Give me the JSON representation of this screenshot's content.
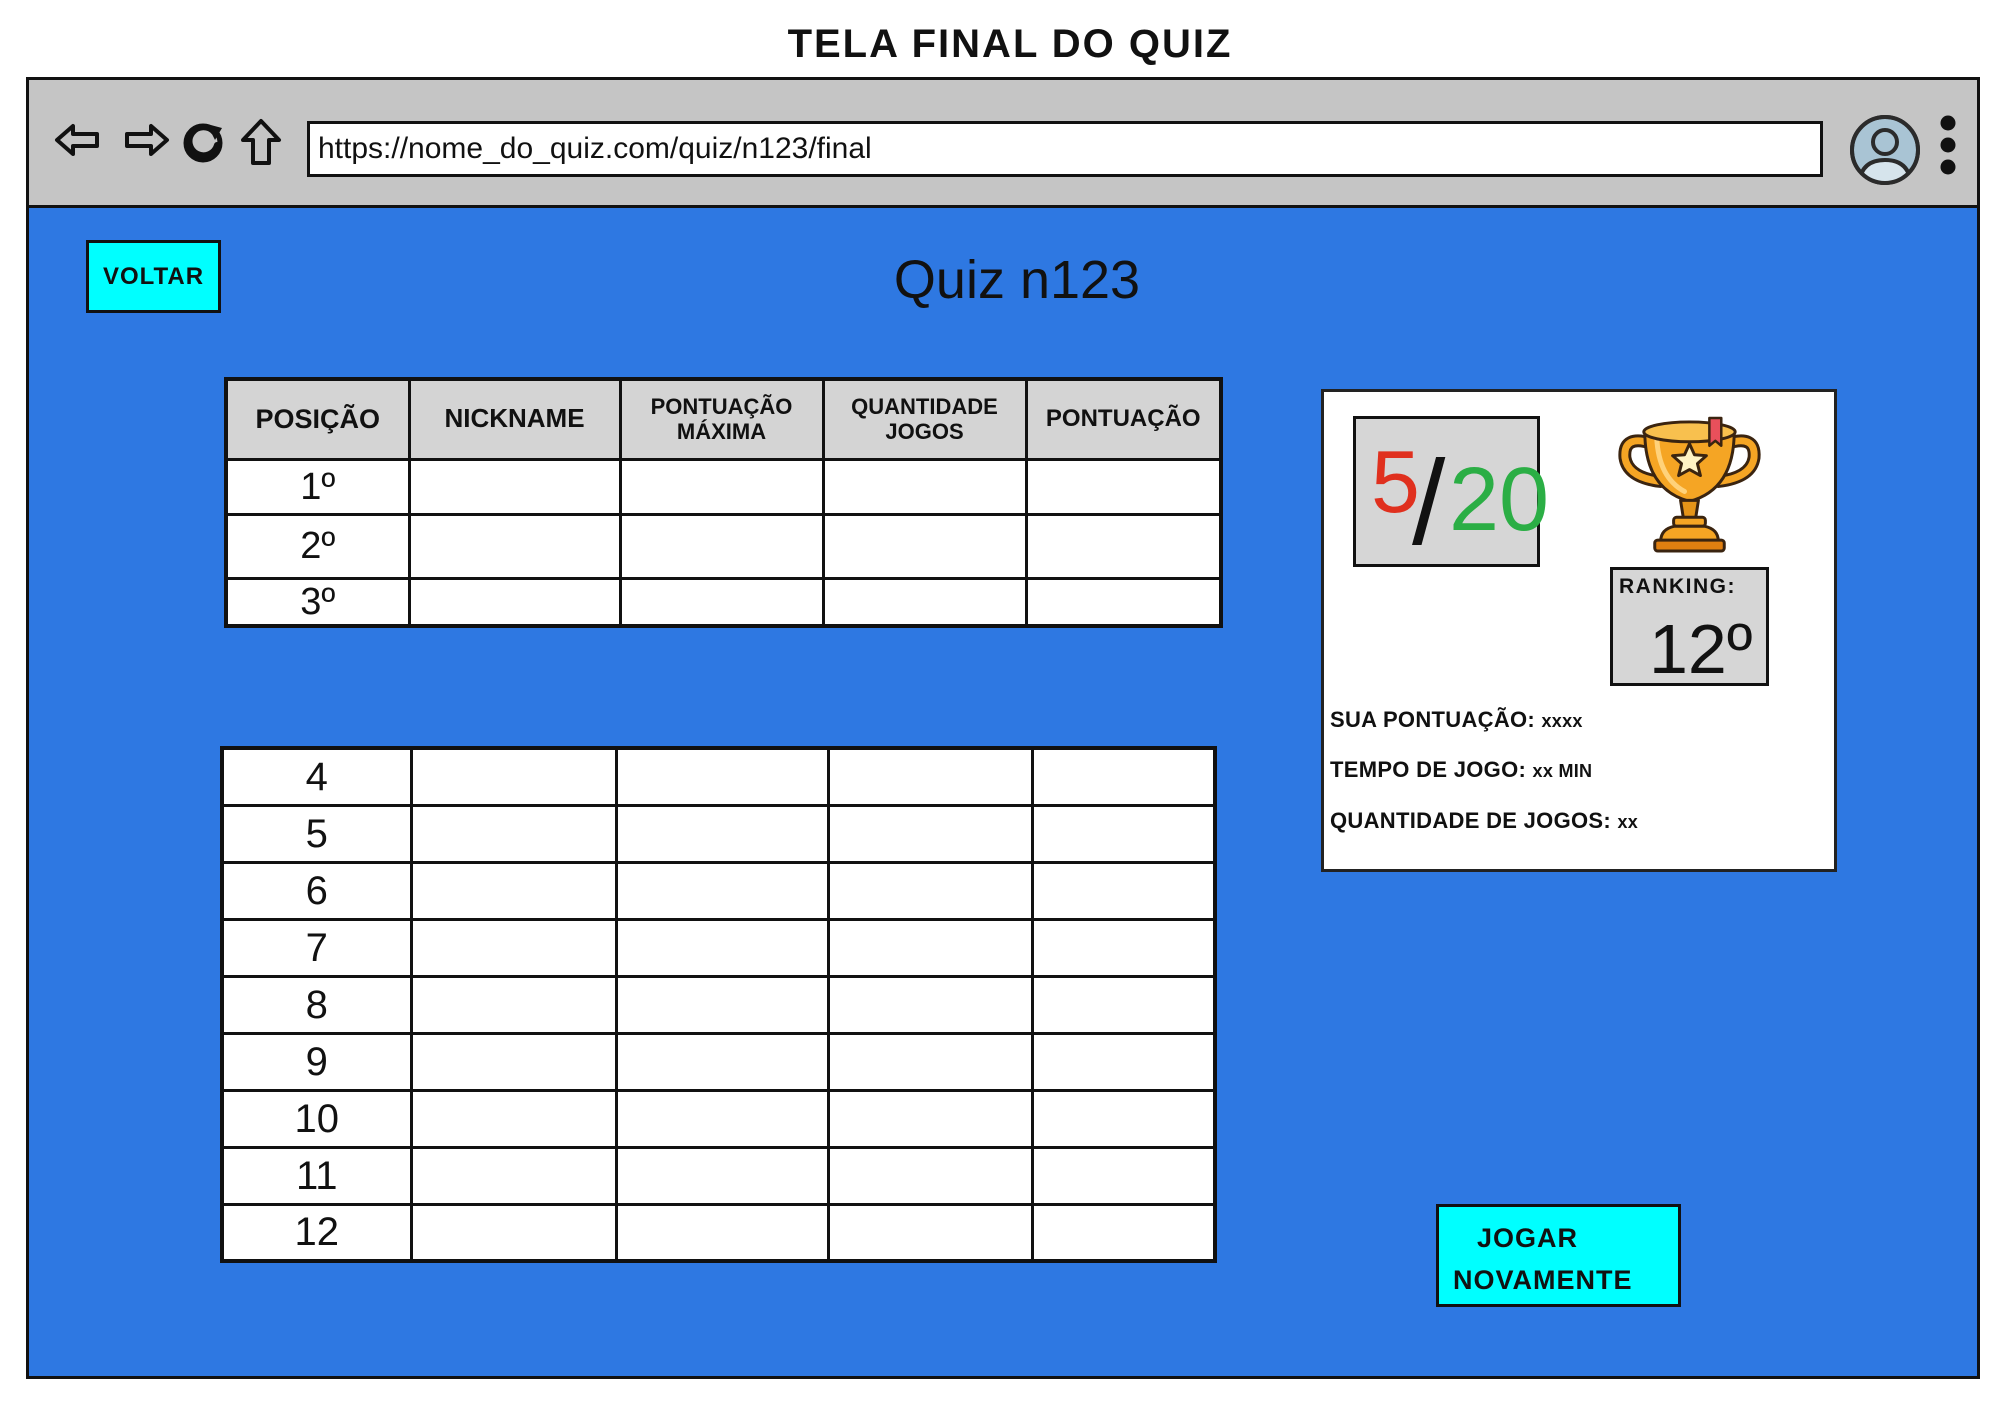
{
  "page_title": "TELA FINAL DO QUIZ",
  "browser": {
    "url": "https://nome_do_quiz.com/quiz/n123/final",
    "nav_icons": [
      "arrow-left-icon",
      "arrow-right-icon",
      "refresh-icon",
      "home-icon"
    ],
    "profile_icon": "user-avatar-icon",
    "menu_icon": "kebab-menu-icon"
  },
  "header": {
    "back_label": "VOLTAR",
    "quiz_title": "Quiz n123"
  },
  "top_table": {
    "columns": [
      "POSIÇÃO",
      "NICKNAME",
      "PONTUAÇÃO MÁXIMA",
      "QUANTIDADE JOGOS",
      "PONTUAÇÃO"
    ],
    "rows": [
      [
        "1º",
        "",
        "",
        "",
        ""
      ],
      [
        "2º",
        "",
        "",
        "",
        ""
      ],
      [
        "3º",
        "",
        "",
        "",
        ""
      ]
    ]
  },
  "bottom_table": {
    "rows": [
      [
        "4",
        "",
        "",
        "",
        ""
      ],
      [
        "5",
        "",
        "",
        "",
        ""
      ],
      [
        "6",
        "",
        "",
        "",
        ""
      ],
      [
        "7",
        "",
        "",
        "",
        ""
      ],
      [
        "8",
        "",
        "",
        "",
        ""
      ],
      [
        "9",
        "",
        "",
        "",
        ""
      ],
      [
        "10",
        "",
        "",
        "",
        ""
      ],
      [
        "11",
        "",
        "",
        "",
        ""
      ],
      [
        "12",
        "",
        "",
        "",
        ""
      ]
    ]
  },
  "result_card": {
    "score": {
      "correct": "5",
      "separator": "/",
      "total": "20"
    },
    "trophy_icon": "trophy-icon",
    "ranking": {
      "label": "RANKING:",
      "value": "12º"
    },
    "stats": [
      {
        "label": "SUA PONTUAÇÃO:",
        "value": "xxxx"
      },
      {
        "label": "TEMPO DE JOGO:",
        "value": "xx MIN"
      },
      {
        "label": "QUANTIDADE DE JOGOS:",
        "value": "xx"
      }
    ]
  },
  "play_again_label": "JOGAR NOVAMENTE",
  "colors": {
    "content_bg": "#2E78E2",
    "toolbar_bg": "#C5C5C5",
    "button_bg": "#00FFFF",
    "table_header_bg": "#D4D4D4",
    "score_box_bg": "#D6D6D6",
    "correct_color": "#E0301E",
    "total_color": "#2BAE45"
  }
}
